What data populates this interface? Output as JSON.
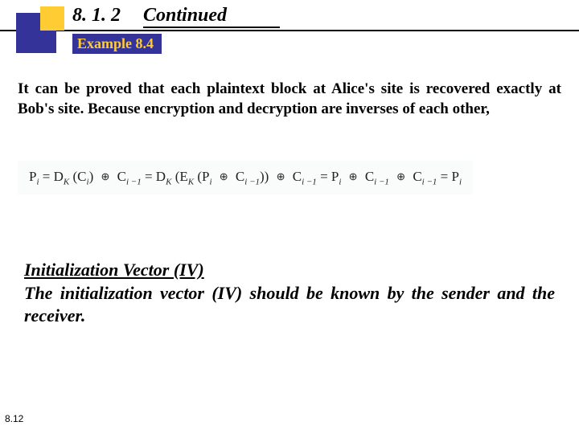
{
  "header": {
    "section_number": "8. 1. 2",
    "section_title": "Continued",
    "example_label": "Example 8.4"
  },
  "paragraph1": "It can be proved that each plaintext block at Alice's site is recovered exactly at Bob's site. Because encryption and decryption are inverses of each other,",
  "formula": {
    "p1": "P",
    "i": "i",
    "eq": "=",
    "D": "D",
    "K": "K",
    "C": "C",
    "im1": "i −1",
    "E": "E",
    "full_text": "P_i = D_K (C_i)  ⊕  C_{i−1} = D_K (E_K (P_i ⊕ C_{i−1})) ⊕ C_{i−1} = P_i ⊕ C_{i−1} ⊕ C_{i−1} = P_i"
  },
  "iv": {
    "heading": "Initialization Vector (IV)",
    "body": "The initialization vector (IV) should be known by the sender and the receiver."
  },
  "page_number": "8.12"
}
